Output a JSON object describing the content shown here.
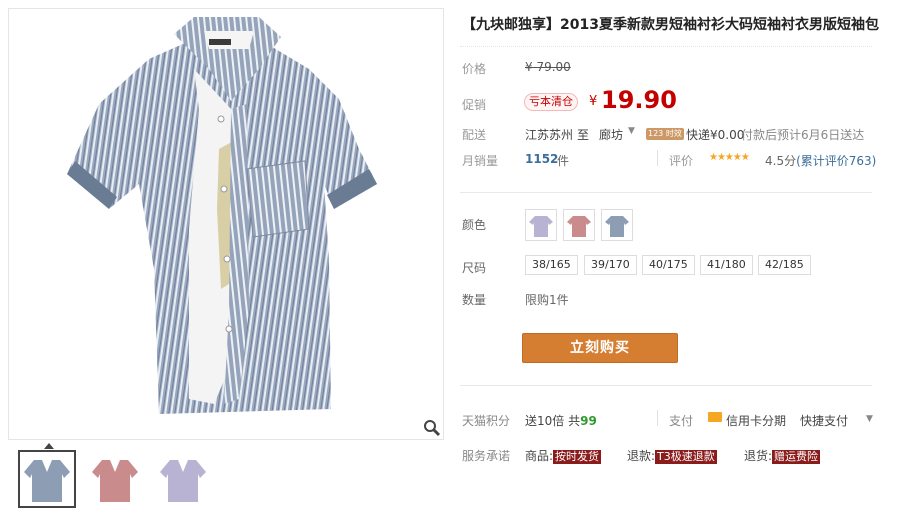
{
  "product": {
    "title": "【九块邮独享】2013夏季新款男短袖衬衫大码短袖衬衣男版短袖包"
  },
  "price": {
    "label_price": "价格",
    "original": "¥ 79.00",
    "label_promo": "促销",
    "promo_tag": "亏本清仓",
    "currency": "¥",
    "current": "19.90"
  },
  "shipping": {
    "label": "配送",
    "from": "江苏苏州",
    "to_word": "至",
    "to": "廊坊",
    "tag": "123 时效",
    "express": "快递¥0.00",
    "note": "付款后预计6月6日送达"
  },
  "sales": {
    "label": "月销量",
    "count": "1152",
    "unit": "件",
    "rating_label": "评价",
    "stars": "★★★★★",
    "score": "4.5分",
    "reviews": "(累计评价763)"
  },
  "options": {
    "color_label": "颜色",
    "size_label": "尺码",
    "sizes": [
      "38/165",
      "39/170",
      "40/175",
      "41/180",
      "42/185"
    ],
    "qty_label": "数量",
    "qty_value": "限购1件"
  },
  "buy": {
    "label": "立刻购买"
  },
  "points": {
    "label": "天猫积分",
    "text": "送10倍 共",
    "value": "99"
  },
  "payment": {
    "label": "支付",
    "card": "信用卡分期",
    "quick": "快捷支付"
  },
  "service": {
    "label": "服务承诺",
    "item1_prefix": "商品:",
    "item1_tag": "按时发货",
    "item2_prefix": "退款:",
    "item2_tag": "T3极速退款",
    "item3_prefix": "退货:",
    "item3_tag": "赠运费险"
  },
  "colors": {
    "accent": "#c40000",
    "buy_button": "#d57d30",
    "link": "#3c6e9b",
    "shirt_blue": "#8c9db4",
    "shirt_red": "#c98b8b",
    "shirt_lilac": "#b8b3d2"
  },
  "icons": [
    "zoom-icon",
    "chevron-down-icon",
    "credit-card-icon",
    "star-icon"
  ]
}
